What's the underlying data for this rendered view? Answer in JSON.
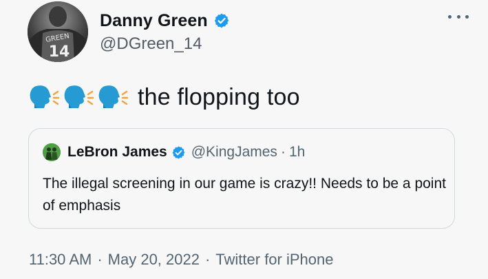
{
  "author": {
    "display_name": "Danny Green",
    "handle": "@DGreen_14",
    "verified": true,
    "avatar_jersey_text": "GREEN",
    "avatar_jersey_number": "14"
  },
  "tweet": {
    "emojis": [
      "speaking-head-icon",
      "speaking-head-icon",
      "speaking-head-icon"
    ],
    "text": "the flopping too"
  },
  "quote": {
    "display_name": "LeBron James",
    "handle": "@KingJames",
    "separator": "·",
    "time": "1h",
    "verified": true,
    "text": "The illegal screening in our game is crazy!! Needs to be a point of emphasis"
  },
  "footer": {
    "time": "11:30 AM",
    "date": "May 20, 2022",
    "source": "Twitter for iPhone",
    "separator": "·"
  },
  "colors": {
    "background": "#f7f7f7",
    "text": "#0f1419",
    "secondary": "#536471",
    "verified_blue": "#1d9bf0",
    "border": "#cfd9de"
  }
}
